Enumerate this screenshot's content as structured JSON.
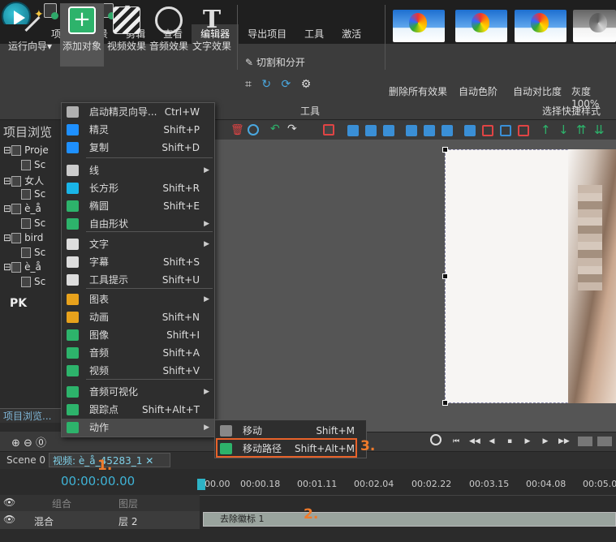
{
  "menubar": {
    "tabs": [
      "项目",
      "场景",
      "剪辑",
      "查看",
      "编辑器",
      "导出项目",
      "工具",
      "激活"
    ],
    "active": "编辑器"
  },
  "ribbon": {
    "buttons": [
      "运行向导",
      "添加对象",
      "视频效果",
      "音频效果",
      "文字效果"
    ],
    "cut_label": "切割和分开",
    "tools_label": "工具",
    "styles_label": "选择快捷样式",
    "style_thumbs": [
      "删除所有效果",
      "自动色阶",
      "自动对比度",
      "灰度100%"
    ]
  },
  "left_panel": {
    "title": "项目浏览",
    "tree": [
      {
        "label": "Proje",
        "indent": 0
      },
      {
        "label": "Sc",
        "indent": 1
      },
      {
        "label": "女人",
        "indent": 0
      },
      {
        "label": "Sc",
        "indent": 1
      },
      {
        "label": "è_å",
        "indent": 0
      },
      {
        "label": "Sc",
        "indent": 1
      },
      {
        "label": "bird",
        "indent": 0
      },
      {
        "label": "Sc",
        "indent": 1
      },
      {
        "label": "è_å",
        "indent": 0
      },
      {
        "label": "Sc",
        "indent": 1
      }
    ],
    "watermark": "PK",
    "bottom_tab": "项目浏览..."
  },
  "dropdown": {
    "items": [
      {
        "label": "启动精灵向导...",
        "shortcut": "Ctrl+W",
        "sub": false,
        "icon": "wand-icon",
        "color": "#b0b0b0"
      },
      {
        "label": "精灵",
        "shortcut": "Shift+P",
        "sub": false,
        "icon": "sprite-icon",
        "color": "#1e90ff"
      },
      {
        "label": "复制",
        "shortcut": "Shift+D",
        "sub": false,
        "icon": "copy-icon",
        "color": "#1e90ff"
      },
      {
        "label": "线",
        "shortcut": "",
        "sub": true,
        "icon": "line-icon",
        "color": "#cccccc"
      },
      {
        "label": "长方形",
        "shortcut": "Shift+R",
        "sub": false,
        "icon": "rectangle-icon",
        "color": "#19b5e8"
      },
      {
        "label": "椭圆",
        "shortcut": "Shift+E",
        "sub": false,
        "icon": "ellipse-icon",
        "color": "#2db36b"
      },
      {
        "label": "自由形状",
        "shortcut": "",
        "sub": true,
        "icon": "freeform-icon",
        "color": "#2db36b"
      },
      {
        "label": "文字",
        "shortcut": "",
        "sub": true,
        "icon": "text-icon",
        "color": "#dddddd"
      },
      {
        "label": "字幕",
        "shortcut": "Shift+S",
        "sub": false,
        "icon": "subtitle-icon",
        "color": "#dddddd"
      },
      {
        "label": "工具提示",
        "shortcut": "Shift+U",
        "sub": false,
        "icon": "tooltip-icon",
        "color": "#dddddd"
      },
      {
        "label": "图表",
        "shortcut": "",
        "sub": true,
        "icon": "chart-icon",
        "color": "#e8a21c"
      },
      {
        "label": "动画",
        "shortcut": "Shift+N",
        "sub": false,
        "icon": "animation-icon",
        "color": "#e8a21c"
      },
      {
        "label": "图像",
        "shortcut": "Shift+I",
        "sub": false,
        "icon": "image-icon",
        "color": "#2db36b"
      },
      {
        "label": "音频",
        "shortcut": "Shift+A",
        "sub": false,
        "icon": "audio-icon",
        "color": "#2db36b"
      },
      {
        "label": "视频",
        "shortcut": "Shift+V",
        "sub": false,
        "icon": "video-icon",
        "color": "#2db36b"
      },
      {
        "label": "音频可视化",
        "shortcut": "",
        "sub": true,
        "icon": "audio-visual-icon",
        "color": "#2db36b"
      },
      {
        "label": "跟踪点",
        "shortcut": "Shift+Alt+T",
        "sub": false,
        "icon": "tracking-icon",
        "color": "#2db36b"
      },
      {
        "label": "动作",
        "shortcut": "",
        "sub": true,
        "icon": "motion-icon",
        "color": "#2db36b"
      }
    ]
  },
  "submenu": {
    "items": [
      {
        "label": "移动",
        "shortcut": "Shift+M"
      },
      {
        "label": "移动路径",
        "shortcut": "Shift+Alt+M"
      }
    ]
  },
  "steps": [
    "1.",
    "2.",
    "3."
  ],
  "timeline": {
    "tabs": [
      "Scene 0",
      "视频: è_å_45283_1"
    ],
    "timecode": "00:00:00.00",
    "ticks": [
      "00.00",
      "00:00.18",
      "00:01.11",
      "00:02.04",
      "00:02.22",
      "00:03.15",
      "00:04.08",
      "00:05.0"
    ],
    "layer_head": [
      "组合",
      "图层"
    ],
    "layer_row": {
      "blend": "混合",
      "name": "层 2"
    },
    "clip_label": "去除徽标 1"
  },
  "colors": {
    "accent_orange": "#e8622a",
    "timecode_blue": "#3fb3d6"
  }
}
